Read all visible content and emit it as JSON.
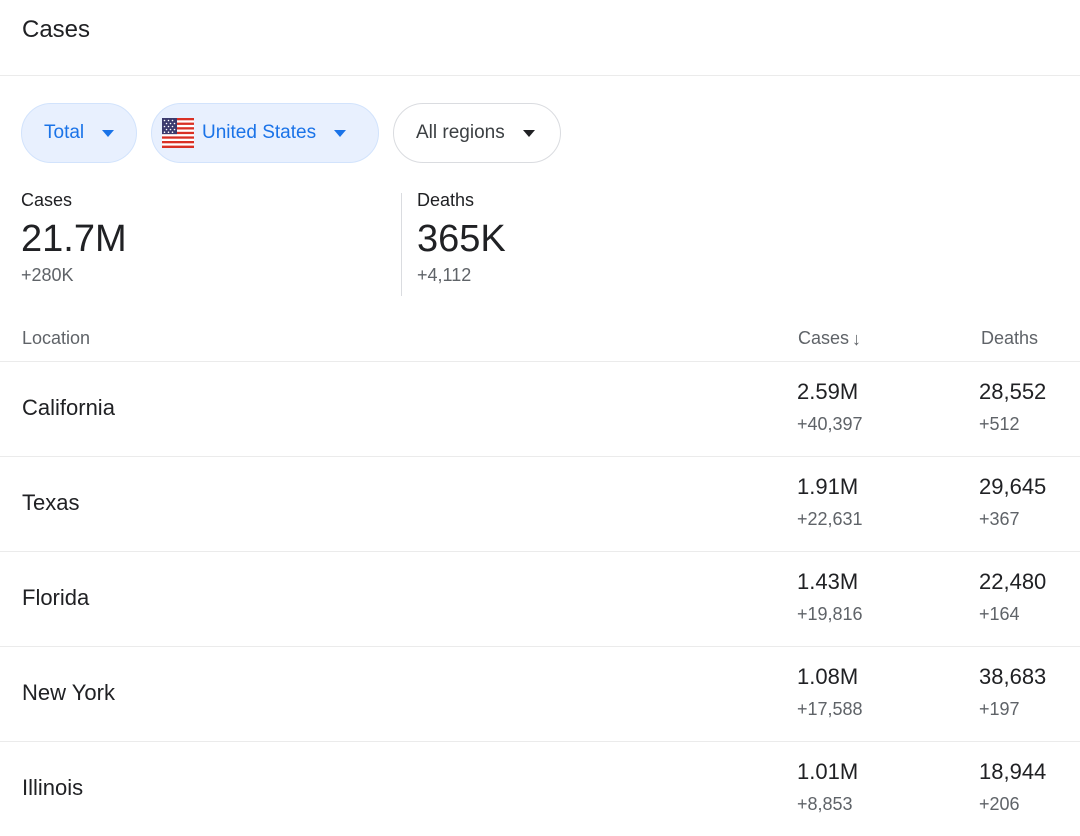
{
  "header": {
    "title": "Cases"
  },
  "filters": {
    "total": {
      "label": "Total"
    },
    "country": {
      "label": "United States",
      "flag_icon": "us-flag-icon"
    },
    "region": {
      "label": "All regions"
    }
  },
  "summary": {
    "cases": {
      "label": "Cases",
      "value": "21.7M",
      "delta": "+280K"
    },
    "deaths": {
      "label": "Deaths",
      "value": "365K",
      "delta": "+4,112"
    }
  },
  "table": {
    "headers": {
      "location": "Location",
      "cases": "Cases",
      "sort_icon": "↓",
      "deaths": "Deaths"
    },
    "rows": [
      {
        "location": "California",
        "cases": "2.59M",
        "cases_delta": "+40,397",
        "deaths": "28,552",
        "deaths_delta": "+512"
      },
      {
        "location": "Texas",
        "cases": "1.91M",
        "cases_delta": "+22,631",
        "deaths": "29,645",
        "deaths_delta": "+367"
      },
      {
        "location": "Florida",
        "cases": "1.43M",
        "cases_delta": "+19,816",
        "deaths": "22,480",
        "deaths_delta": "+164"
      },
      {
        "location": "New York",
        "cases": "1.08M",
        "cases_delta": "+17,588",
        "deaths": "38,683",
        "deaths_delta": "+197"
      },
      {
        "location": "Illinois",
        "cases": "1.01M",
        "cases_delta": "+8,853",
        "deaths": "18,944",
        "deaths_delta": "+206"
      }
    ]
  },
  "colors": {
    "accent": "#1a73e8",
    "chip_selected_bg": "#e8f0fe",
    "text_primary": "#202124",
    "text_secondary": "#5f6368",
    "divider": "#ebebeb"
  }
}
